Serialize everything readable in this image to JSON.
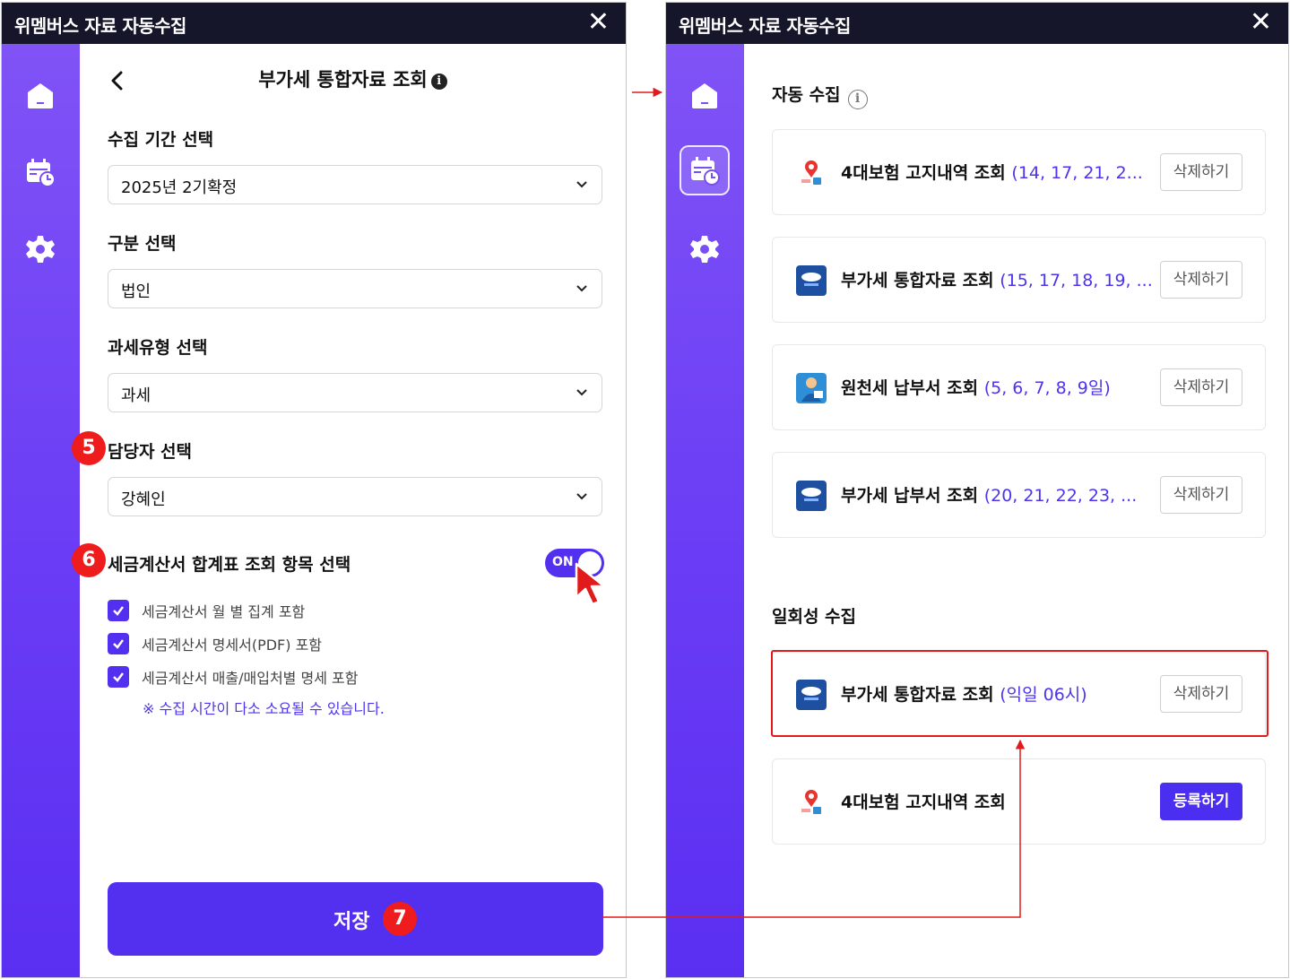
{
  "left_window": {
    "title": "위멤버스 자료 자동수집",
    "close_glyph": "✕",
    "page_title": "부가세 통합자료 조회",
    "info_glyph": "i",
    "fields": [
      {
        "label": "수집 기간 선택",
        "value": "2025년 2기확정"
      },
      {
        "label": "구분 선택",
        "value": "법인"
      },
      {
        "label": "과세유형 선택",
        "value": "과세"
      },
      {
        "label": "담당자 선택",
        "value": "강혜인"
      }
    ],
    "toggle_section": {
      "label": "세금계산서 합계표 조회 항목 선택",
      "toggle_text": "ON",
      "toggle_on": true
    },
    "checkboxes": [
      {
        "label": "세금계산서 월 별 집계 포함",
        "checked": true
      },
      {
        "label": "세금계산서 명세서(PDF) 포함",
        "checked": true
      },
      {
        "label": "세금계산서 매출/매입처별 명세 포함",
        "checked": true
      }
    ],
    "note": "※ 수집 시간이 다소 소요될 수 있습니다.",
    "save_label": "저장"
  },
  "badges": {
    "b5": "5",
    "b6": "6",
    "b7": "7"
  },
  "right_window": {
    "title": "위멤버스 자료 자동수집",
    "close_glyph": "✕",
    "auto_section": {
      "title": "자동 수집",
      "info_glyph": "i",
      "items": [
        {
          "name": "4대보험 고지내역 조회",
          "schedule": "(14, 17, 21, 2...",
          "icon": "insurance-icon",
          "button": "삭제하기"
        },
        {
          "name": "부가세 통합자료 조회",
          "schedule": "(15, 17, 18, 19, ...",
          "icon": "hometax-icon",
          "button": "삭제하기"
        },
        {
          "name": "원천세 납부서 조회",
          "schedule": "(5, 6, 7, 8, 9일)",
          "icon": "person-icon",
          "button": "삭제하기"
        },
        {
          "name": "부가세 납부서 조회",
          "schedule": "(20, 21, 22, 23, ...",
          "icon": "hometax-icon",
          "button": "삭제하기"
        }
      ]
    },
    "one_time_section": {
      "title": "일회성 수집",
      "items": [
        {
          "name": "부가세 통합자료 조회",
          "schedule": "(익일 06시)",
          "icon": "hometax-icon",
          "button": "삭제하기"
        },
        {
          "name": "4대보험 고지내역 조회",
          "schedule": "",
          "icon": "insurance-icon",
          "button": "등록하기"
        }
      ]
    }
  },
  "colors": {
    "titlebar": "#16162a",
    "sidebar": "#6a3cf5",
    "accent": "#5330ef",
    "schedule_text": "#4c34ee",
    "badge_red": "#ee1c1c",
    "highlight_red": "#e11b1b"
  }
}
